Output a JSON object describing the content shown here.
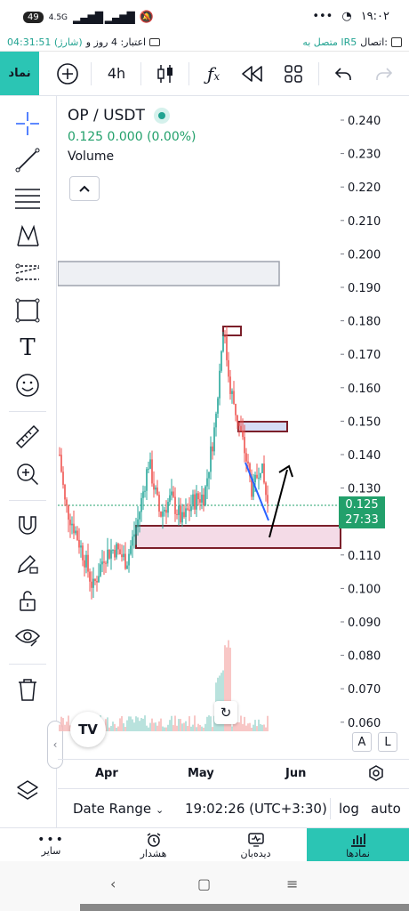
{
  "status_bar": {
    "battery": "49",
    "network": "4.5G",
    "time": "۱۹:۰۲",
    "dots": "•••"
  },
  "account": {
    "balance_text": "04:31:51 (شارژ)",
    "credit_label": "اعتبار: 4 روز و",
    "connection_label": "اتصال:",
    "connection_status": "متصل به IR5"
  },
  "toolbar": {
    "symbols_label": "نماد",
    "interval": "4h"
  },
  "legend": {
    "symbol": "OP / USDT",
    "price": "0.125",
    "change": "0.000",
    "change_pct": "(0.00%)",
    "volume_label": "Volume"
  },
  "price_axis": {
    "ticks": [
      "0.240",
      "0.230",
      "0.220",
      "0.210",
      "0.200",
      "0.190",
      "0.180",
      "0.170",
      "0.160",
      "0.150",
      "0.140",
      "0.130",
      "0.110",
      "0.100",
      "0.090",
      "0.080",
      "0.070",
      "0.060"
    ],
    "current_price": "0.125",
    "countdown": "27:33"
  },
  "scale_buttons": {
    "a": "A",
    "l": "L"
  },
  "time_axis": {
    "labels": [
      "Apr",
      "May",
      "Jun"
    ]
  },
  "chart_bottom": {
    "date_range": "Date Range",
    "clock": "19:02:26 (UTC+3:30)",
    "log": "log",
    "auto": "auto"
  },
  "bottom_nav": {
    "items": [
      {
        "label": "سایر"
      },
      {
        "label": "هشدار"
      },
      {
        "label": "دیده‌بان"
      },
      {
        "label": "نمادها"
      }
    ]
  },
  "chart_data": {
    "type": "candlestick",
    "symbol": "OP / USDT",
    "interval": "4h",
    "ylim": [
      0.055,
      0.245
    ],
    "close_path": [
      {
        "t": 0,
        "v": 0.14
      },
      {
        "t": 3,
        "v": 0.125
      },
      {
        "t": 8,
        "v": 0.118
      },
      {
        "t": 14,
        "v": 0.108
      },
      {
        "t": 18,
        "v": 0.1
      },
      {
        "t": 24,
        "v": 0.11
      },
      {
        "t": 30,
        "v": 0.112
      },
      {
        "t": 36,
        "v": 0.108
      },
      {
        "t": 42,
        "v": 0.12
      },
      {
        "t": 48,
        "v": 0.138
      },
      {
        "t": 54,
        "v": 0.122
      },
      {
        "t": 60,
        "v": 0.127
      },
      {
        "t": 66,
        "v": 0.12
      },
      {
        "t": 72,
        "v": 0.126
      },
      {
        "t": 78,
        "v": 0.128
      },
      {
        "t": 84,
        "v": 0.15
      },
      {
        "t": 88,
        "v": 0.178
      },
      {
        "t": 92,
        "v": 0.16
      },
      {
        "t": 96,
        "v": 0.15
      },
      {
        "t": 100,
        "v": 0.14
      },
      {
        "t": 104,
        "v": 0.128
      },
      {
        "t": 108,
        "v": 0.138
      },
      {
        "t": 112,
        "v": 0.125
      }
    ]
  }
}
